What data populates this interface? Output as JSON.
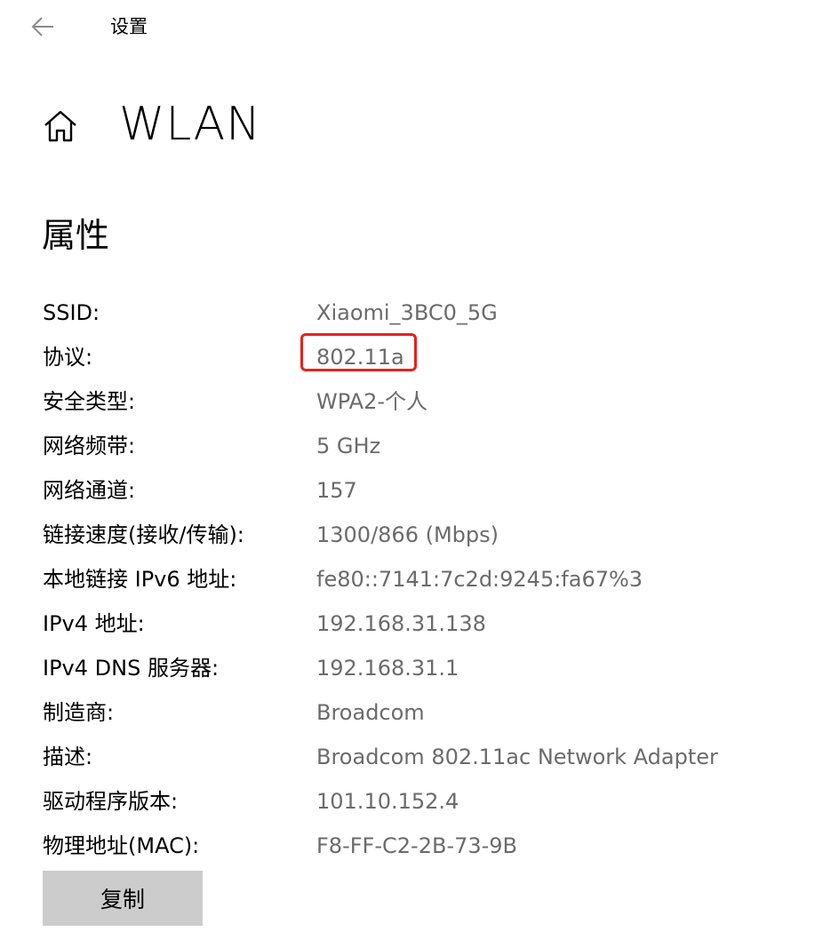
{
  "header": {
    "back_icon": "back-arrow-icon",
    "app_title": "设置"
  },
  "page": {
    "home_icon": "home-icon",
    "title": "WLAN"
  },
  "section": {
    "title": "属性"
  },
  "properties": [
    {
      "label": "SSID:",
      "value": "Xiaomi_3BC0_5G"
    },
    {
      "label": "协议:",
      "value": "802.11a"
    },
    {
      "label": "安全类型:",
      "value": "WPA2-个人"
    },
    {
      "label": "网络频带:",
      "value": "5 GHz"
    },
    {
      "label": "网络通道:",
      "value": "157"
    },
    {
      "label": "链接速度(接收/传输):",
      "value": "1300/866 (Mbps)"
    },
    {
      "label": "本地链接 IPv6 地址:",
      "value": "fe80::7141:7c2d:9245:fa67%3"
    },
    {
      "label": "IPv4 地址:",
      "value": "192.168.31.138"
    },
    {
      "label": "IPv4 DNS 服务器:",
      "value": "192.168.31.1"
    },
    {
      "label": "制造商:",
      "value": "Broadcom"
    },
    {
      "label": "描述:",
      "value": "Broadcom 802.11ac Network Adapter"
    },
    {
      "label": "驱动程序版本:",
      "value": "101.10.152.4"
    },
    {
      "label": "物理地址(MAC):",
      "value": "F8-FF-C2-2B-73-9B"
    }
  ],
  "copy_button": {
    "label": "复制"
  },
  "colors": {
    "highlight_border": "#e8211c",
    "value_text": "#6b6b6b",
    "button_bg": "#cccccc"
  }
}
